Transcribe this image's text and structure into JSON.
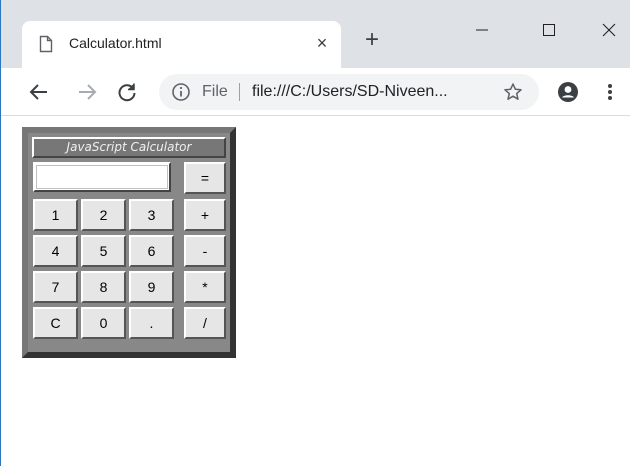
{
  "browser": {
    "tab": {
      "title": "Calculator.html",
      "close_glyph": "×"
    },
    "new_tab_glyph": "+",
    "omnibox": {
      "scheme_label": "File",
      "url": "file:///C:/Users/SD-Niveen..."
    },
    "icons": {
      "page": "page-icon",
      "back": "arrow-left-icon",
      "forward": "arrow-right-icon",
      "reload": "reload-icon",
      "info": "info-icon",
      "star": "star-icon",
      "profile": "account-icon",
      "menu": "kebab-menu-icon",
      "minimize": "minimize-icon",
      "maximize": "maximize-icon",
      "close": "close-icon"
    },
    "colors": {
      "tabstrip": "#dee1e6",
      "omnibox": "#f1f3f4",
      "window_border": "#2b78c0"
    }
  },
  "calculator": {
    "title": "JavaScript Calculator",
    "display_value": "",
    "equals_label": "=",
    "rows": [
      [
        "1",
        "2",
        "3",
        "+"
      ],
      [
        "4",
        "5",
        "6",
        "-"
      ],
      [
        "7",
        "8",
        "9",
        "*"
      ],
      [
        "C",
        "0",
        ".",
        "/"
      ]
    ],
    "colors": {
      "frame": "#777777",
      "key_face": "#e6e6e6",
      "title_text": "#f0f0f0"
    }
  }
}
